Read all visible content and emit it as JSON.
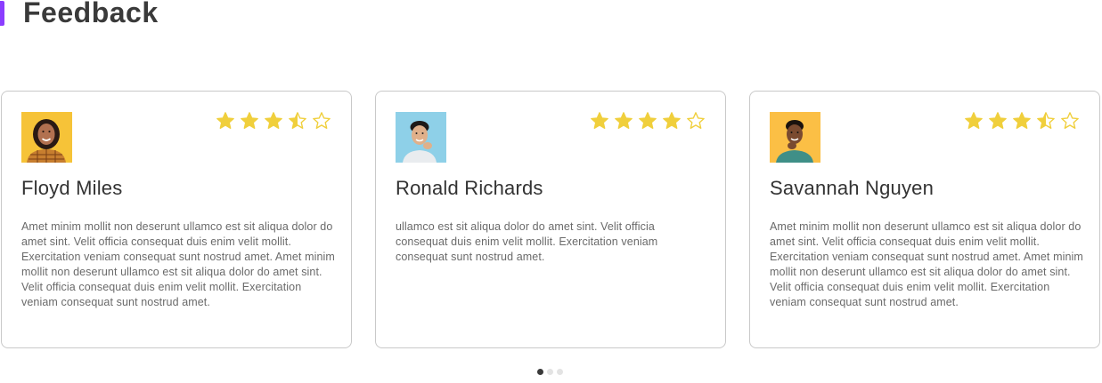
{
  "section": {
    "title": "Feedback",
    "accent_color": "#8b3dff"
  },
  "star_color": "#f0cf3c",
  "testimonials": [
    {
      "name": "Floyd Miles",
      "rating": 3.5,
      "avatar_bg": "#f6c338",
      "text": "Amet minim mollit non deserunt ullamco est sit aliqua dolor do amet sint. Velit officia consequat duis enim velit mollit.\nExercitation veniam consequat sunt nostrud amet. Amet minim mollit non deserunt ullamco est sit aliqua dolor do amet sint. Velit officia consequat duis enim velit mollit. Exercitation veniam consequat sunt nostrud amet."
    },
    {
      "name": "Ronald Richards",
      "rating": 4,
      "avatar_bg": "#8ed0e8",
      "text": "ullamco est sit aliqua dolor do amet sint. Velit officia consequat duis enim velit mollit. Exercitation veniam consequat sunt nostrud amet."
    },
    {
      "name": "Savannah Nguyen",
      "rating": 3.5,
      "avatar_bg": "#fbbf45",
      "text": "Amet minim mollit non deserunt ullamco est sit aliqua dolor do amet sint. Velit officia consequat duis enim velit mollit.\nExercitation veniam consequat sunt nostrud amet. Amet minim mollit non deserunt ullamco est sit aliqua dolor do amet sint. Velit officia consequat duis enim velit mollit. Exercitation veniam consequat sunt nostrud amet."
    }
  ],
  "pager": {
    "count": 3,
    "active_index": 0
  }
}
